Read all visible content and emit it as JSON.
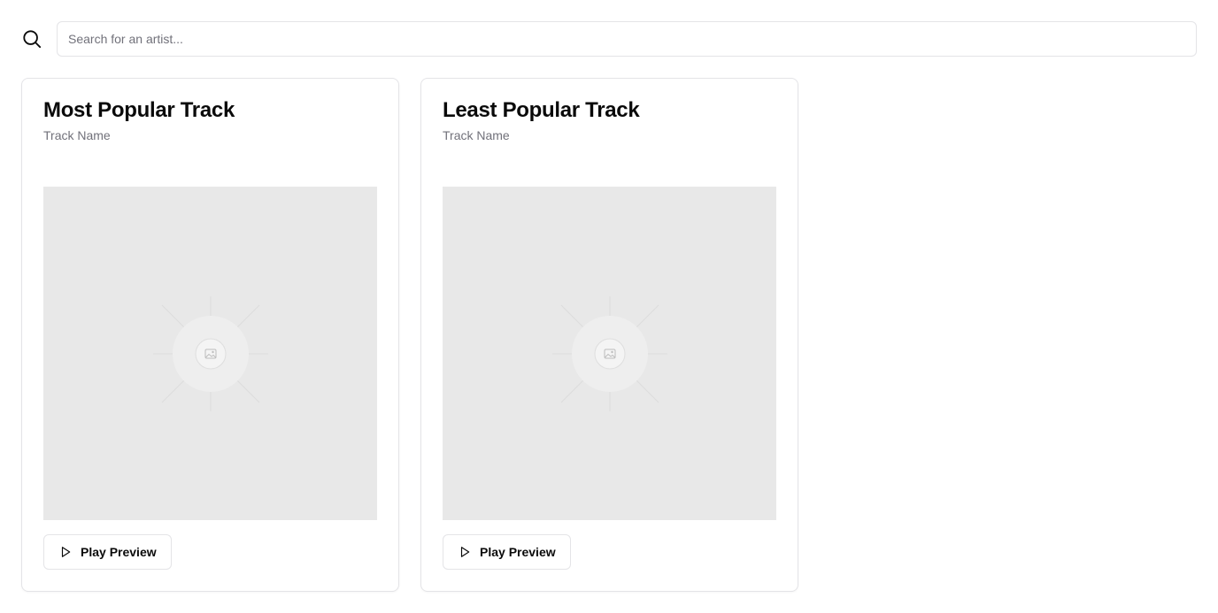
{
  "search": {
    "placeholder": "Search for an artist...",
    "value": "",
    "icon": "search-icon"
  },
  "cards": [
    {
      "title": "Most Popular Track",
      "track_name": "Track Name",
      "image": "image-placeholder-icon",
      "button_label": "Play Preview",
      "button_icon": "play-icon"
    },
    {
      "title": "Least Popular Track",
      "track_name": "Track Name",
      "image": "image-placeholder-icon",
      "button_label": "Play Preview",
      "button_icon": "play-icon"
    }
  ],
  "colors": {
    "border": "#e4e4e7",
    "muted_text": "#71717a",
    "placeholder_bg": "#e8e8e8",
    "text": "#0a0a0a"
  }
}
